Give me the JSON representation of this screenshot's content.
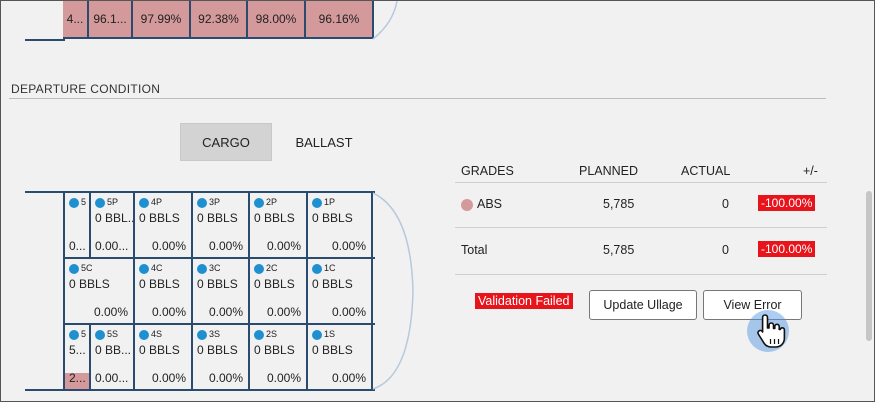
{
  "top_row": [
    "4...",
    "96.1...",
    "97.99%",
    "92.38%",
    "98.00%",
    "96.16%"
  ],
  "section_title": "DEPARTURE CONDITION",
  "tabs": {
    "cargo": "CARGO",
    "ballast": "BALLAST"
  },
  "grades": {
    "headers": {
      "grades": "GRADES",
      "planned": "PLANNED",
      "actual": "ACTUAL",
      "diff": "+/-"
    },
    "rows": [
      {
        "name": "ABS",
        "planned": "5,785",
        "actual": "0",
        "diff": "-100.00%"
      }
    ],
    "total": {
      "name": "Total",
      "planned": "5,785",
      "actual": "0",
      "diff": "-100.00%"
    }
  },
  "actions": {
    "validation": "Validation Failed",
    "update": "Update Ullage",
    "view_error": "View Error"
  },
  "tanks": {
    "row1": [
      {
        "id": "5",
        "vol": "0...",
        "pct": ""
      },
      {
        "id": "5P",
        "vol": "0 BBL...",
        "pct": "0.00..."
      },
      {
        "id": "4P",
        "vol": "0 BBLS",
        "pct": "0.00%"
      },
      {
        "id": "3P",
        "vol": "0 BBLS",
        "pct": "0.00%"
      },
      {
        "id": "2P",
        "vol": "0 BBLS",
        "pct": "0.00%"
      },
      {
        "id": "1P",
        "vol": "0 BBLS",
        "pct": "0.00%"
      }
    ],
    "row2": [
      {
        "id": "5C",
        "vol": "0 BBLS",
        "pct": "0.00%"
      },
      {
        "id": "4C",
        "vol": "0 BBLS",
        "pct": "0.00%"
      },
      {
        "id": "3C",
        "vol": "0 BBLS",
        "pct": "0.00%"
      },
      {
        "id": "2C",
        "vol": "0 BBLS",
        "pct": "0.00%"
      },
      {
        "id": "1C",
        "vol": "0 BBLS",
        "pct": "0.00%"
      }
    ],
    "row3": [
      {
        "id": "5",
        "vol": "5...",
        "pct": "2..."
      },
      {
        "id": "5S",
        "vol": "0 BB...",
        "pct": "0.00..."
      },
      {
        "id": "4S",
        "vol": "0 BBLS",
        "pct": "0.00%"
      },
      {
        "id": "3S",
        "vol": "0 BBLS",
        "pct": "0.00%"
      },
      {
        "id": "2S",
        "vol": "0 BBLS",
        "pct": "0.00%"
      },
      {
        "id": "1S",
        "vol": "0 BBLS",
        "pct": "0.00%"
      }
    ]
  },
  "colors": {
    "fill": "#d4999b",
    "badge": "#e8141c",
    "marker": "#1e90d0",
    "grid": "#2a4a6e"
  }
}
